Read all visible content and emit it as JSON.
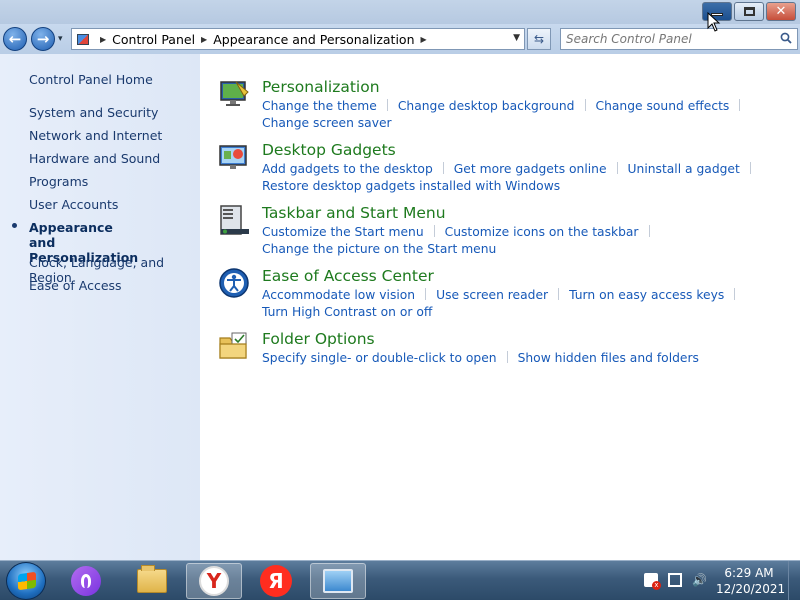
{
  "window": {
    "minimize_icon": "minimize-icon",
    "maximize_icon": "maximize-icon",
    "close_glyph": "✕"
  },
  "navigation": {
    "back_glyph": "←",
    "forward_glyph": "→",
    "history_glyph": "▾",
    "breadcrumbs": [
      "Control Panel",
      "Appearance and Personalization"
    ],
    "refresh_glyph": "⇆",
    "search_placeholder": "Search Control Panel"
  },
  "sidebar": {
    "home": "Control Panel Home",
    "items": [
      "System and Security",
      "Network and Internet",
      "Hardware and Sound",
      "Programs",
      "User Accounts",
      "Appearance and Personalization",
      "Clock, Language, and Region",
      "Ease of Access"
    ],
    "active_index": 5
  },
  "sections": [
    {
      "title": "Personalization",
      "icon": "personalization-icon",
      "links": [
        "Change the theme",
        "Change desktop background",
        "Change sound effects",
        "Change screen saver"
      ]
    },
    {
      "title": "Desktop Gadgets",
      "icon": "gadgets-icon",
      "links": [
        "Add gadgets to the desktop",
        "Get more gadgets online",
        "Uninstall a gadget",
        "Restore desktop gadgets installed with Windows"
      ]
    },
    {
      "title": "Taskbar and Start Menu",
      "icon": "taskbar-icon",
      "links": [
        "Customize the Start menu",
        "Customize icons on the taskbar",
        "Change the picture on the Start menu"
      ]
    },
    {
      "title": "Ease of Access Center",
      "icon": "ease-of-access-icon",
      "links": [
        "Accommodate low vision",
        "Use screen reader",
        "Turn on easy access keys",
        "Turn High Contrast on or off"
      ]
    },
    {
      "title": "Folder Options",
      "icon": "folder-options-icon",
      "links": [
        "Specify single- or double-click to open",
        "Show hidden files and folders"
      ]
    }
  ],
  "taskbar": {
    "yandex_browser_glyph": "Y",
    "yandex_glyph": "Я",
    "clock_time": "6:29 AM",
    "clock_date": "12/20/2021",
    "tray_flag_glyph": "x",
    "tray_volume_glyph": "🔊"
  },
  "colors": {
    "link": "#1759b8",
    "section_title": "#1e7a1e",
    "sidebar_bg": "#e7eefa",
    "taskbar": "#3b5a7a"
  }
}
